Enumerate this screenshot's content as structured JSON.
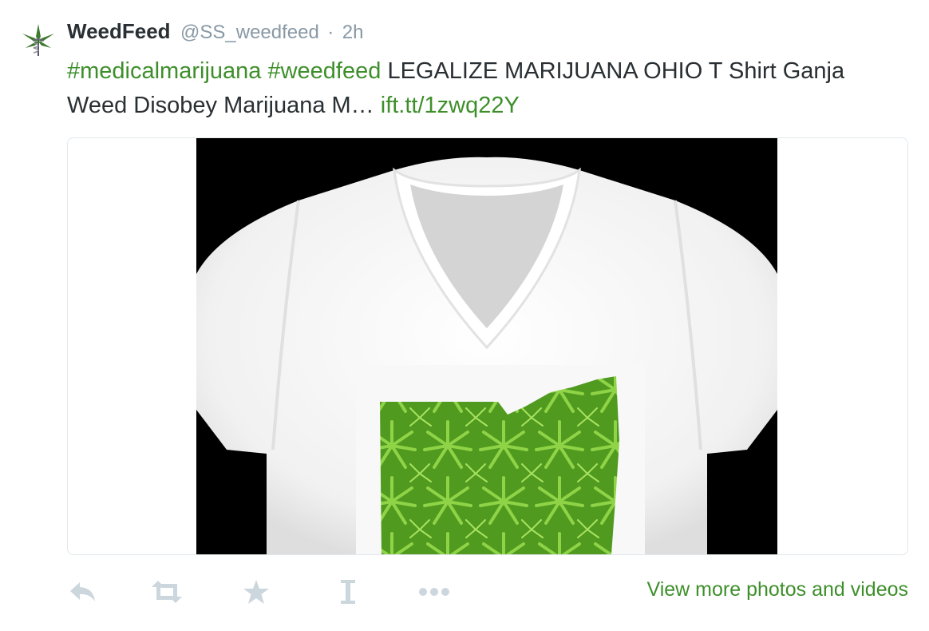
{
  "tweet": {
    "author_name": "WeedFeed",
    "author_handle": "@SS_weedfeed",
    "separator": "·",
    "timestamp": "2h",
    "hashtags": [
      "#medicalmarijuana",
      "#weedfeed"
    ],
    "body_text": "LEGALIZE MARIJUANA OHIO T Shirt Ganja Weed Disobey Marijuana M…",
    "link_text": "ift.tt/1zwq22Y"
  },
  "media": {
    "icon": "cannabis-leaf-ohio-map-on-white-v-neck-tshirt"
  },
  "actions": {
    "reply_icon": "reply-icon",
    "retweet_icon": "retweet-icon",
    "favorite_icon": "star-icon",
    "ifttt_icon": "ifttt-icon",
    "more_icon": "more-dots-icon",
    "view_more_label": "View more photos and videos"
  },
  "colors": {
    "link_green": "#3e8f2b",
    "muted_gray": "#8899a6",
    "action_gray": "#ccd6dd",
    "text_dark": "#292f33"
  }
}
